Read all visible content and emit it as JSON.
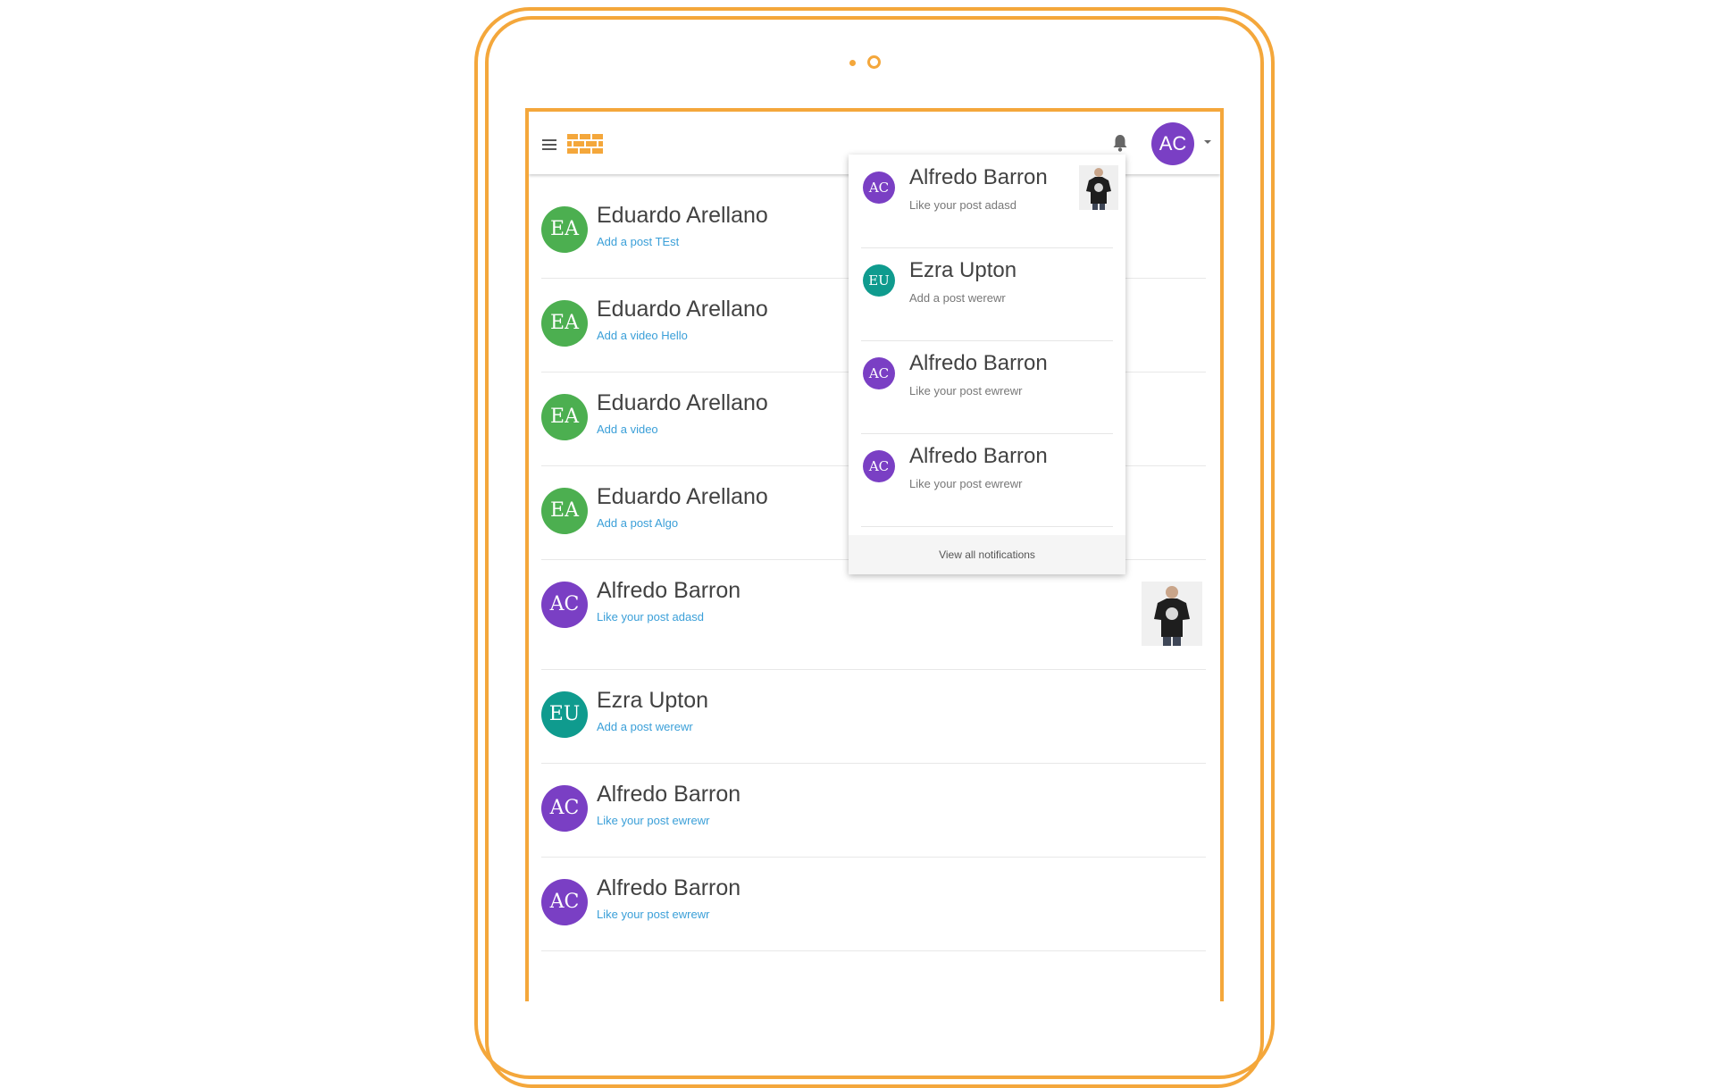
{
  "colors": {
    "accent": "#f4a73b",
    "link": "#3a9fd8",
    "purple": "#7a3fc4",
    "green": "#4caf50",
    "teal": "#0f9b8e"
  },
  "header": {
    "menu_icon": "menu-icon",
    "logo_icon": "brick-logo-icon",
    "bell_icon": "bell-icon",
    "user_initials": "AC",
    "caret_icon": "caret-down-icon"
  },
  "feed": [
    {
      "initials": "EA",
      "color": "#4caf50",
      "name": "Eduardo Arellano",
      "action": "Add a post TEst"
    },
    {
      "initials": "EA",
      "color": "#4caf50",
      "name": "Eduardo Arellano",
      "action": "Add a video Hello"
    },
    {
      "initials": "EA",
      "color": "#4caf50",
      "name": "Eduardo Arellano",
      "action": "Add a video"
    },
    {
      "initials": "EA",
      "color": "#4caf50",
      "name": "Eduardo Arellano",
      "action": "Add a post Algo"
    },
    {
      "initials": "AC",
      "color": "#7a3fc4",
      "name": "Alfredo Barron",
      "action": "Like your post adasd",
      "thumbnail": "tshirt-photo"
    },
    {
      "initials": "EU",
      "color": "#0f9b8e",
      "name": "Ezra Upton",
      "action": "Add a post werewr"
    },
    {
      "initials": "AC",
      "color": "#7a3fc4",
      "name": "Alfredo Barron",
      "action": "Like your post ewrewr"
    },
    {
      "initials": "AC",
      "color": "#7a3fc4",
      "name": "Alfredo Barron",
      "action": "Like your post ewrewr"
    }
  ],
  "notifications": {
    "items": [
      {
        "initials": "AC",
        "color": "#7a3fc4",
        "name": "Alfredo Barron",
        "action": "Like your post adasd",
        "thumbnail": "tshirt-photo"
      },
      {
        "initials": "EU",
        "color": "#0f9b8e",
        "name": "Ezra Upton",
        "action": "Add a post werewr"
      },
      {
        "initials": "AC",
        "color": "#7a3fc4",
        "name": "Alfredo Barron",
        "action": "Like your post ewrewr"
      },
      {
        "initials": "AC",
        "color": "#7a3fc4",
        "name": "Alfredo Barron",
        "action": "Like your post ewrewr"
      }
    ],
    "view_all": "View all notifications"
  }
}
